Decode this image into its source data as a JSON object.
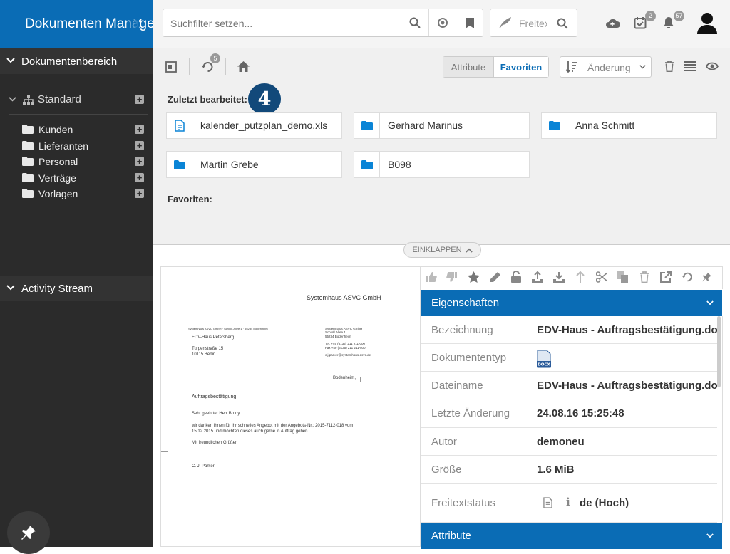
{
  "app": {
    "title": "Dokumenten Manager"
  },
  "sidebar": {
    "section_documents": "Dokumentenbereich",
    "tree_root": "Standard",
    "folders": [
      {
        "label": "Kunden"
      },
      {
        "label": "Lieferanten"
      },
      {
        "label": "Personal"
      },
      {
        "label": "Verträge"
      },
      {
        "label": "Vorlagen"
      }
    ],
    "section_activity": "Activity Stream"
  },
  "search": {
    "placeholder": "Suchfilter setzen...",
    "fulltext_label": "Freitext"
  },
  "header": {
    "tasks_count": "2",
    "notifications_count": "57"
  },
  "toolbar": {
    "history_count": "5",
    "toggle": {
      "attributes": "Attribute",
      "favorites": "Favoriten",
      "active": "Favoriten"
    },
    "sort_label": "Änderung"
  },
  "recent": {
    "label": "Zuletzt bearbeitet:",
    "step_badge": "4",
    "items": [
      {
        "label": "kalender_putzplan_demo.xls",
        "type": "file"
      },
      {
        "label": "Gerhard Marinus",
        "type": "folder"
      },
      {
        "label": "Anna Schmitt",
        "type": "folder"
      },
      {
        "label": "Martin Grebe",
        "type": "folder"
      },
      {
        "label": "B098",
        "type": "folder"
      }
    ]
  },
  "favorites": {
    "label": "Favoriten:"
  },
  "collapse": {
    "label": "EINKLAPPEN"
  },
  "preview": {
    "company": "Systemhaus ASVC GmbH",
    "sender_line": "Systemhaus ASVC GmbH · Schloß Allee 1 · 55234 Bodenheim",
    "recipient_name": "EDV-Haus Petersberg",
    "recipient_street": "Turpenstraße 15",
    "recipient_city": "10115 Berlin",
    "sender_block": [
      "Systemhaus ASVC GmbH",
      "Schloß Allee 1",
      "55234 Bodenheim",
      "",
      "Tel.   +49 (6135) 211 211-000",
      "Fax   +49 (6135) 211 211-500",
      "",
      "c.j.parker@systemhaus-asvc.de"
    ],
    "place": "Bodenheim,",
    "subject": "Auftragsbestätigung",
    "salutation": "Sehr geehrter Herr Brody,",
    "body1": "wir danken Ihnen für Ihr schnelles Angebot mit der Angebots-Nr.: 2015-7112-018 vom",
    "body2": "15.12.2015 und möchten dieses auch gerne in Auftrag geben.",
    "closing": "Mit freundlichen Grüßen",
    "signature": "C. J. Parker"
  },
  "properties": {
    "header": "Eigenschaften",
    "rows": [
      {
        "label": "Bezeichnung",
        "value": "EDV-Haus - Auftragsbestätigung.docx"
      },
      {
        "label": "Dokumententyp",
        "value": ""
      },
      {
        "label": "Dateiname",
        "value": "EDV-Haus - Auftragsbestätigung.docx"
      },
      {
        "label": "Letzte Änderung",
        "value": "24.08.16 15:25:48"
      },
      {
        "label": "Autor",
        "value": "demoneu"
      },
      {
        "label": "Größe",
        "value": "1.6 MiB"
      },
      {
        "label": "Freitextstatus",
        "value": "de (Hoch)"
      }
    ],
    "doc_type_badge": "DOCX"
  },
  "attributes_panel": {
    "header": "Attribute"
  },
  "colors": {
    "brand": "#0a6cb5",
    "sidebar": "#2b2b2b",
    "folder": "#0a84d6",
    "badge": "#12497a"
  }
}
